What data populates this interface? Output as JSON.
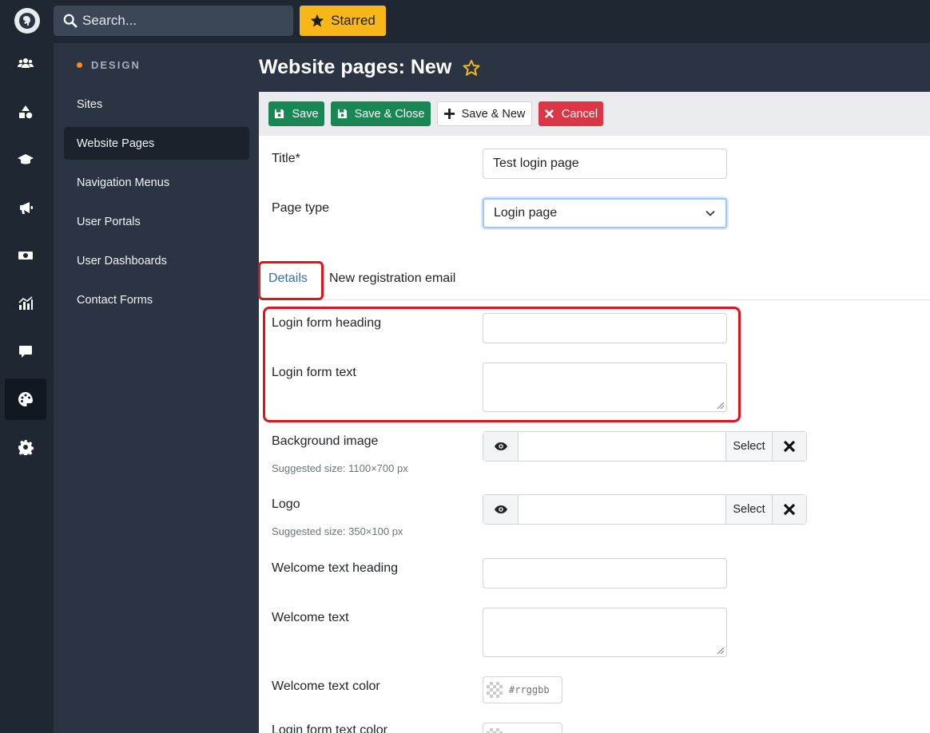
{
  "topbar": {
    "search_placeholder": "Search...",
    "starred_label": "Starred",
    "logo_icon": "elephant-logo-icon"
  },
  "rail": {
    "items": [
      {
        "icon": "users-icon"
      },
      {
        "icon": "shapes-icon"
      },
      {
        "icon": "graduation-cap-icon"
      },
      {
        "icon": "megaphone-icon"
      },
      {
        "icon": "money-icon"
      },
      {
        "icon": "chart-icon"
      },
      {
        "icon": "comment-icon"
      },
      {
        "icon": "palette-icon",
        "active": true
      },
      {
        "icon": "gear-icon"
      }
    ]
  },
  "sidebar": {
    "section_title": "DESIGN",
    "items": [
      {
        "label": "Sites"
      },
      {
        "label": "Website Pages",
        "active": true
      },
      {
        "label": "Navigation Menus"
      },
      {
        "label": "User Portals"
      },
      {
        "label": "User Dashboards"
      },
      {
        "label": "Contact Forms"
      }
    ]
  },
  "page": {
    "title": "Website pages: New"
  },
  "toolbar": {
    "save_label": "Save",
    "save_close_label": "Save & Close",
    "save_new_label": "Save & New",
    "cancel_label": "Cancel"
  },
  "form": {
    "title_label": "Title*",
    "title_value": "Test login page",
    "page_type_label": "Page type",
    "page_type_value": "Login page",
    "tabs": [
      {
        "label": "Details",
        "active": true
      },
      {
        "label": "New registration email"
      }
    ],
    "login_heading_label": "Login form heading",
    "login_text_label": "Login form text",
    "bg_image_label": "Background image",
    "bg_image_hint": "Suggested size: 1100×700 px",
    "logo_label": "Logo",
    "logo_hint": "Suggested size: 350×100 px",
    "select_label": "Select",
    "welcome_heading_label": "Welcome text heading",
    "welcome_text_label": "Welcome text",
    "welcome_color_label": "Welcome text color",
    "color_placeholder": "#rrggbb",
    "login_color_label": "Login form text color"
  },
  "colors": {
    "accent_green": "#198754",
    "accent_red": "#dc3545",
    "starred_yellow": "#f7b718",
    "highlight_red": "#e0141a"
  }
}
